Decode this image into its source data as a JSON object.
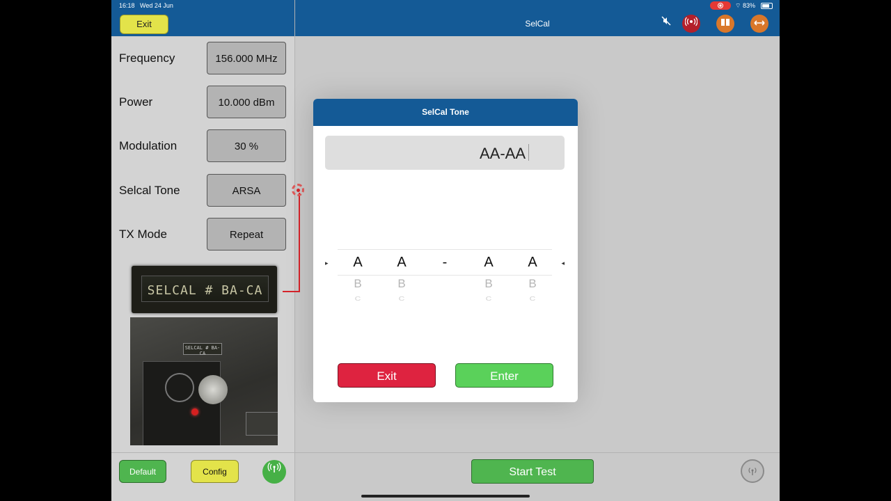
{
  "status_bar": {
    "time": "16:18",
    "date": "Wed 24 Jun",
    "battery": "83%"
  },
  "header": {
    "exit_label": "Exit",
    "title": "SelCal",
    "icons": [
      {
        "name": "mute-icon",
        "glyph": "🔕",
        "color": ""
      },
      {
        "name": "radio-broadcast-icon",
        "glyph": "((•))",
        "color": "#b3202a"
      },
      {
        "name": "book-icon",
        "glyph": "▯▯",
        "color": "#d9772a"
      },
      {
        "name": "resize-arrows-icon",
        "glyph": "⟷",
        "color": "#d9772a"
      }
    ]
  },
  "settings": [
    {
      "label": "Frequency",
      "value": "156.000 MHz"
    },
    {
      "label": "Power",
      "value": "10.000 dBm"
    },
    {
      "label": "Modulation",
      "value": "30 %"
    },
    {
      "label": "Selcal Tone",
      "value": "ARSA"
    },
    {
      "label": "TX Mode",
      "value": "Repeat"
    }
  ],
  "photos": {
    "selcal_plate": "SELCAL # BA-CA",
    "panel_tag": "SELCAL # BA-CA"
  },
  "modal": {
    "title": "SelCal Tone",
    "code": "AA-AA",
    "picker": {
      "columns": [
        {
          "selected": "A",
          "next": "B",
          "next2": "C"
        },
        {
          "selected": "A",
          "next": "B",
          "next2": "C"
        },
        {
          "selected": "-",
          "next": "",
          "next2": ""
        },
        {
          "selected": "A",
          "next": "B",
          "next2": "C"
        },
        {
          "selected": "A",
          "next": "B",
          "next2": "C"
        }
      ]
    },
    "exit_label": "Exit",
    "enter_label": "Enter"
  },
  "footer": {
    "default_label": "Default",
    "config_label": "Config",
    "start_test_label": "Start Test"
  },
  "colors": {
    "header_blue": "#145a96",
    "exit_red": "#de2340",
    "enter_green": "#5ad15a",
    "config_yellow": "#e3e34a"
  }
}
